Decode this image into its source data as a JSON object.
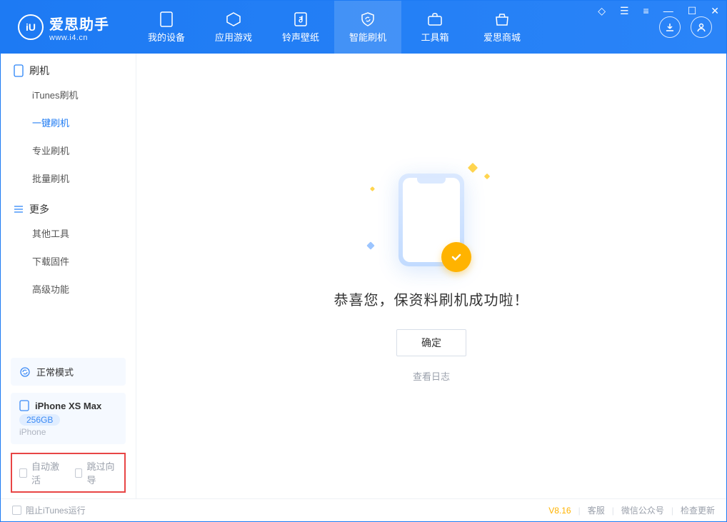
{
  "app": {
    "name": "爱思助手",
    "url": "www.i4.cn",
    "logo_letter": "iU"
  },
  "tabs": [
    {
      "label": "我的设备",
      "icon": "device-icon"
    },
    {
      "label": "应用游戏",
      "icon": "cube-icon"
    },
    {
      "label": "铃声壁纸",
      "icon": "music-note-icon"
    },
    {
      "label": "智能刷机",
      "icon": "shield-refresh-icon"
    },
    {
      "label": "工具箱",
      "icon": "toolbox-icon"
    },
    {
      "label": "爱思商城",
      "icon": "shop-icon"
    }
  ],
  "active_tab_index": 3,
  "sidebar": {
    "sections": [
      {
        "title": "刷机",
        "icon": "phone-outline-icon",
        "items": [
          "iTunes刷机",
          "一键刷机",
          "专业刷机",
          "批量刷机"
        ],
        "active_index": 1
      },
      {
        "title": "更多",
        "icon": "list-lines-icon",
        "items": [
          "其他工具",
          "下载固件",
          "高级功能"
        ],
        "active_index": -1
      }
    ],
    "mode_panel": {
      "label": "正常模式",
      "icon": "sync-icon"
    },
    "device_panel": {
      "name": "iPhone XS Max",
      "storage": "256GB",
      "type": "iPhone",
      "icon": "phone-small-icon"
    },
    "checkboxes": [
      {
        "label": "自动激活",
        "checked": false
      },
      {
        "label": "跳过向导",
        "checked": false
      }
    ]
  },
  "main": {
    "success_text": "恭喜您，保资料刷机成功啦！",
    "ok_label": "确定",
    "log_label": "查看日志"
  },
  "footer": {
    "stop_itunes": "阻止iTunes运行",
    "version": "V8.16",
    "links": [
      "客服",
      "微信公众号",
      "检查更新"
    ]
  }
}
